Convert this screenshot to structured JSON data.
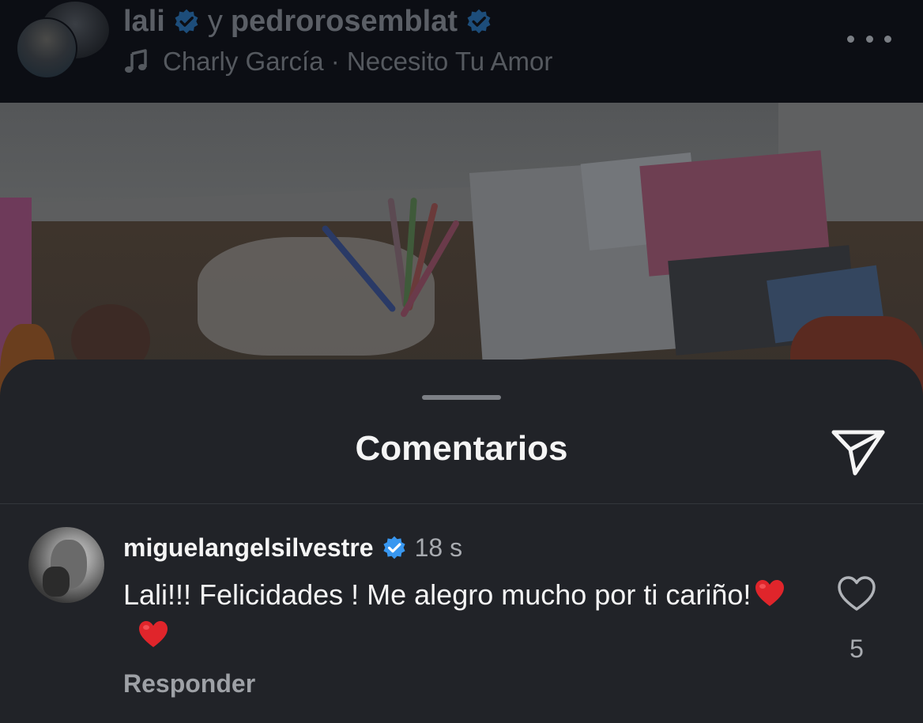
{
  "header": {
    "author_primary": "lali",
    "joiner": "y",
    "author_secondary": "pedrorosemblat",
    "audio": "Charly García · Necesito Tu Amor",
    "icons": [
      "verified-badge-icon",
      "music-note-icon",
      "more-options-icon"
    ]
  },
  "sheet": {
    "title": "Comentarios",
    "share_icon": "send-icon"
  },
  "comment": {
    "username": "miguelangelsilvestre",
    "time": "18 s",
    "text": "Lali!!! Felicidades ! Me alegro mucho por ti cariño!",
    "emoji": "❤️ ❤️",
    "reply_label": "Responder",
    "like_count": "5"
  },
  "colors": {
    "sheet_bg": "#212328",
    "verified": "#3897f0",
    "heart_emoji": "#e0252b"
  }
}
